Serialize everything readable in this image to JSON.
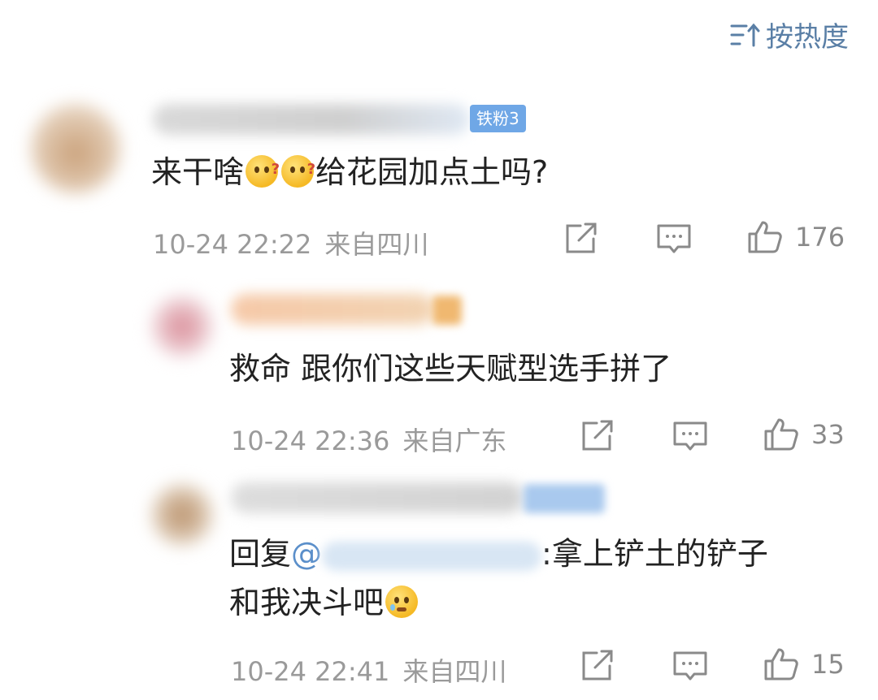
{
  "header": {
    "sort_label": "按热度",
    "sort_icon": "sort-icon"
  },
  "comments": [
    {
      "fan_badge": "铁粉3",
      "text_before": "来干啥",
      "emojis": [
        "thinking-emoji",
        "thinking-emoji"
      ],
      "text_after": "给花园加点土吗?",
      "time": "10-24 22:22",
      "location": "来自四川",
      "likes": "176"
    },
    {
      "text": "救命 跟你们这些天赋型选手拼了",
      "time": "10-24 22:36",
      "location": "来自广东",
      "likes": "33"
    },
    {
      "reply_prefix": "回复",
      "mention_symbol": "@",
      "text_after_mention": ":拿上铲土的铲子",
      "text_line2": "和我决斗吧",
      "emoji": "pleading-emoji",
      "time": "10-24 22:41",
      "location": "来自四川",
      "likes": "15"
    }
  ],
  "actions": {
    "share_icon": "share-icon",
    "comment_icon": "comment-icon",
    "like_icon": "like-icon"
  },
  "colors": {
    "accent": "#5a7fa6",
    "meta": "#9a9a9a",
    "badge": "#6fa7e6",
    "mention": "#5b8fca"
  }
}
